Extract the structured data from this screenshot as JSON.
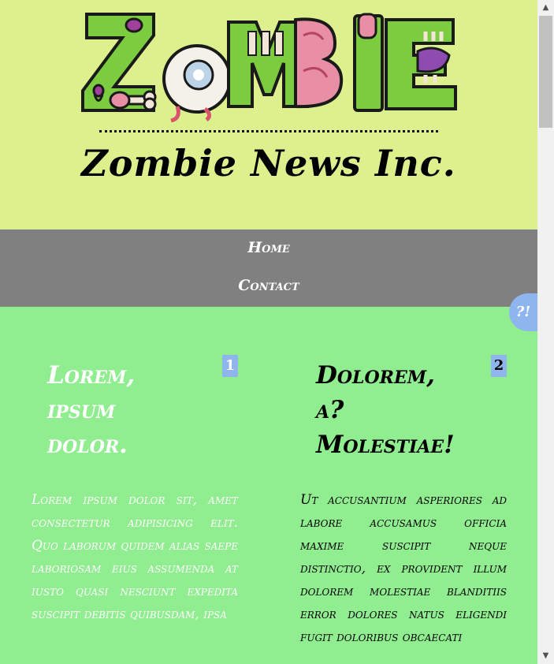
{
  "header": {
    "logo_text": "ZOMBIE",
    "site_title": "Zombie News Inc."
  },
  "nav": {
    "home": "Home",
    "contact": "Contact"
  },
  "help_tab": "?!",
  "articles": [
    {
      "number": "1",
      "title": "Lorem, ipsum dolor.",
      "body": "Lorem ipsum dolor sit, amet consectetur adipisicing elit. Quo laborum quidem alias saepe laboriosam eius assumenda at iusto quasi nesciunt expedita suscipit debitis quibusdam, ipsa"
    },
    {
      "number": "2",
      "title": "Dolorem, a? Molestiae!",
      "body": "Ut accusantium asperiores ad labore accusamus officia maxime suscipit neque distinctio, ex provident illum dolorem molestiae blanditiis error dolores natus eligendi fugit doloribus obcaecati"
    }
  ],
  "colors": {
    "header_bg": "#dcf08e",
    "nav_bg": "#808080",
    "content_bg": "#90ee90",
    "badge_bg": "#8fb5ef"
  },
  "icons": {
    "scroll_up": "triangle-up",
    "scroll_down": "triangle-down"
  }
}
